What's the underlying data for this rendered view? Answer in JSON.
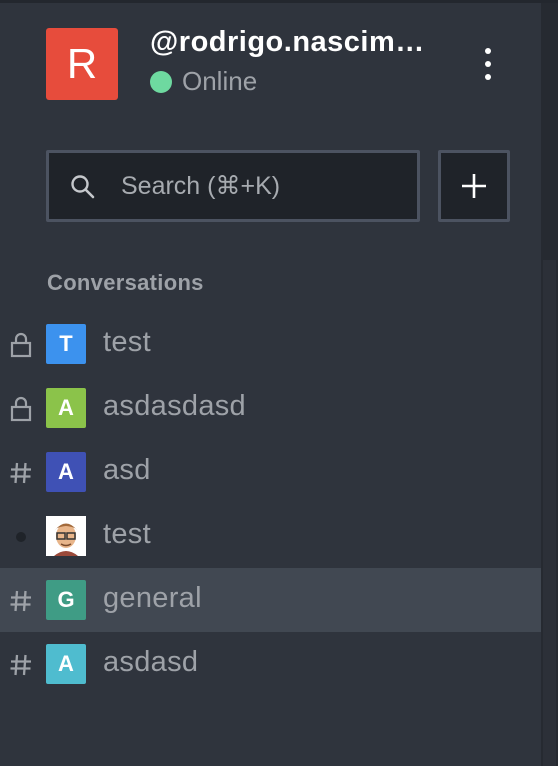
{
  "user": {
    "avatar_letter": "R",
    "avatar_color": "#e74c3c",
    "username": "@rodrigo.nascimento",
    "status": "Online",
    "status_color": "#6ed9a0"
  },
  "search": {
    "placeholder": "Search (⌘+K)"
  },
  "conversations": {
    "title": "Conversations",
    "rooms": [
      {
        "type": "private",
        "icon": "lock-icon",
        "avatar_letter": "T",
        "avatar_color": "#3c92ee",
        "name": "test"
      },
      {
        "type": "private",
        "icon": "lock-icon",
        "avatar_letter": "A",
        "avatar_color": "#8bc34a",
        "name": "asdasdasd"
      },
      {
        "type": "channel",
        "icon": "hash-icon",
        "avatar_letter": "A",
        "avatar_color": "#3f51b5",
        "name": "asd"
      },
      {
        "type": "direct",
        "icon": "status-dot-icon",
        "avatar_letter": "",
        "avatar_color": "#ffffff",
        "name": "test"
      },
      {
        "type": "channel",
        "icon": "hash-icon",
        "avatar_letter": "G",
        "avatar_color": "#3f9c85",
        "name": "general",
        "active": true
      },
      {
        "type": "channel",
        "icon": "hash-icon",
        "avatar_letter": "A",
        "avatar_color": "#4fbccf",
        "name": "asdasd"
      }
    ]
  }
}
